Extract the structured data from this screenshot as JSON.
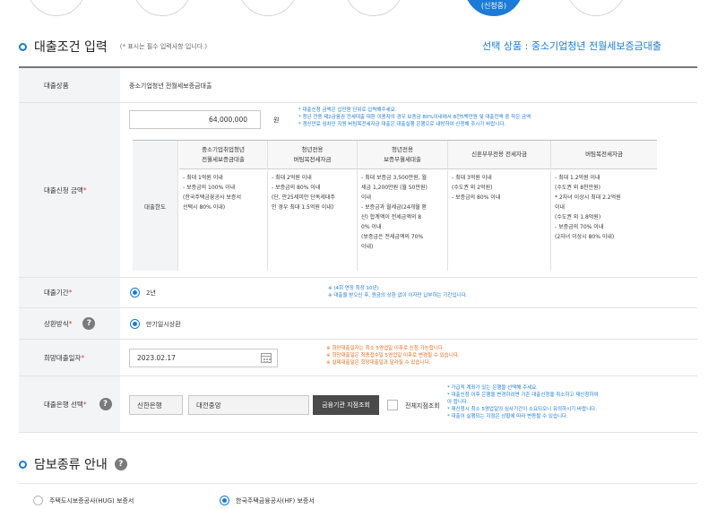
{
  "steps": {
    "active_label": "(신청중)"
  },
  "section1": {
    "title": "대출조건 입력",
    "required_note": "(* 표시는 필수 입력사항 입니다.)",
    "selected_product": "선택 상품 : 중소기업청년 전월세보증금대출"
  },
  "product": {
    "label": "대출상품",
    "value": "중소기업청년 전월세보증금대출"
  },
  "amount": {
    "label": "대출신청 금액",
    "value": "64,000,000",
    "unit": "원",
    "notes": [
      "* 대출신청 금액은 십만원 단위로 입력해주세요.",
      "* 청년 전용 제2금융권 전세대출 대환 이용자의 경우 보증금 80%이내에서 8천5백만원 및 대출잔액 중 작은 금액",
      "* 갱신만료 임차인 지원 버팀목전세자금 대출은 대출실행 은행으로 내방하여 신청해 주시기 바랍니다."
    ],
    "limit_label": "대출한도",
    "columns": [
      {
        "header": [
          "중소기업취업청년",
          "전월세보증금대출"
        ],
        "lines": [
          "- 최대 1억원 이내",
          "- 보증금의 100% 이내",
          "(한국주택금융공사 보증서",
          "선택시 80% 이내)"
        ]
      },
      {
        "header": [
          "청년전용",
          "버팀목전세자금"
        ],
        "lines": [
          "- 최대 2억원 이내",
          "- 보증금의 80% 이내",
          "(단, 만25세미만 단독세대주",
          "인 경우 최대 1.5억원 이내)"
        ]
      },
      {
        "header": [
          "청년전용",
          "보증부월세대출"
        ],
        "lines": [
          "- 최대 보증금 3,500만원, 월",
          "세금 1,200만원 (월 50만원)",
          "이내",
          "- 보증금과 월세금(24개월 환",
          "산) 합계액이 전세금액의 8",
          "0% 이내",
          "(보증금은 전세금액의 70%",
          "이내)"
        ]
      },
      {
        "header": [
          "신혼부부전용 전세자금"
        ],
        "lines": [
          "- 최대 3억원 이내",
          "(수도권 외 2억원)",
          "- 보증금의 80% 이내"
        ]
      },
      {
        "header": [
          "버팀목전세자금"
        ],
        "lines": [
          "- 최대 1.2억원 이내",
          "(수도권 외 8천만원)",
          "* 2자녀 이상시 최대 2.2억원",
          "이내",
          "(수도권 외 1.8억원)",
          "- 보증금의 70% 이내",
          "(2자녀 이상시 80% 이내)"
        ]
      }
    ]
  },
  "period": {
    "label": "대출기간",
    "option": "2년",
    "notes": [
      "※ (4회 연장 최장 10년)",
      "※ 대출을 받으신 후, 원금의 상환 없이 이자만 납부하는 기간입니다."
    ]
  },
  "repay": {
    "label": "상환방식",
    "option": "만기일시상환"
  },
  "date": {
    "label": "희망대출일자",
    "value": "2023.02.17",
    "notes": [
      "※ 희망대출일자는 최소 5영업일 이후로 신청 가능합니다.",
      "※ 희망대출일은 최종접수일 5영업일 이후로 변경될 수 있습니다.",
      "※ 실제대출일은 희망대출일과 달라질 수 있습니다."
    ]
  },
  "bank": {
    "label": "대출은행 선택",
    "bank_name": "신한은행",
    "branch": "대전중앙",
    "search_button": "금융기관 지점조회",
    "all_branch": "전체지점조회",
    "notes": [
      "* 가급적 계좌가 있는 은행을 선택해 주세요.",
      "* 대출신청 이후 은행을 변경하려면 기존 대출신청을 취소하고 재신청하여",
      "야 합니다.",
      "* 재신청시 최소 5영업일의 심사기간이 소요되오니 유의하시기 바랍니다.",
      "* 대출이 실행되는 지점은 상황에 따라 변동될 수 있습니다."
    ]
  },
  "section2": {
    "title": "담보종류 안내",
    "options": [
      "주택도시보증공사(HUG) 보증서",
      "한국주택금융공사(HF) 보증서"
    ],
    "selected_index": 1
  },
  "colors": {
    "accent": "#1b7bd6",
    "required": "#e4403a",
    "warning": "#e86a1a",
    "label_bg": "#f3f4f6"
  }
}
